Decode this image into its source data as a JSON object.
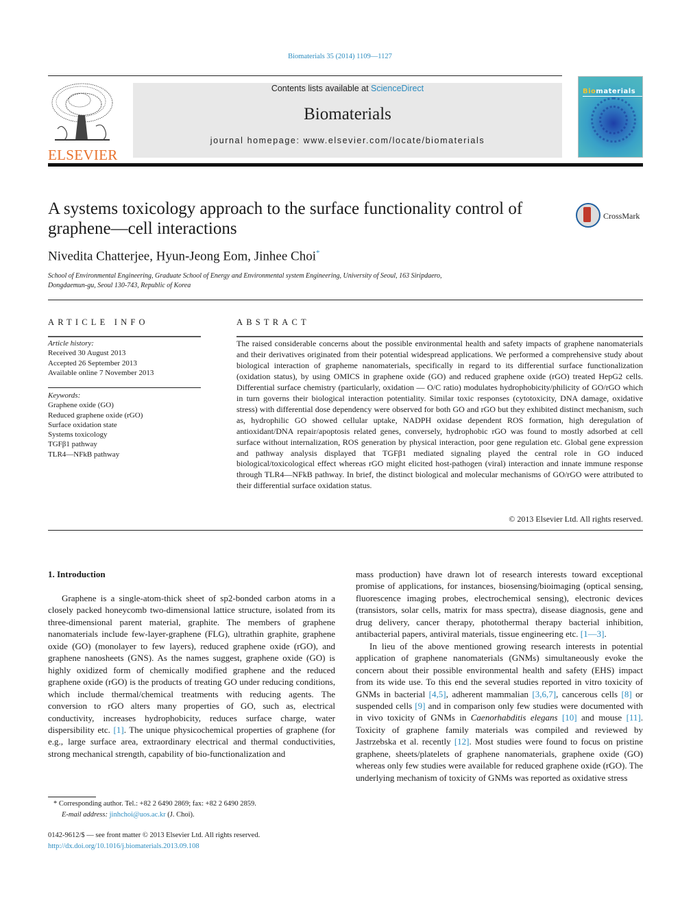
{
  "header": {
    "journal_ref": "Biomaterials 35 (2014) 1109—1127",
    "publisher_logo_text": "ELSEVIER",
    "contents_prefix": "Contents lists available at ",
    "contents_link": "ScienceDirect",
    "journal_name": "Biomaterials",
    "homepage": "journal homepage: www.elsevier.com/locate/biomaterials",
    "cover_title_highlight": "Bio",
    "cover_title_rest": "materials"
  },
  "article": {
    "title": "A systems toxicology approach to the surface functionality control of graphene—cell interactions",
    "crossmark_label": "CrossMark",
    "authors": "Nivedita Chatterjee, Hyun-Jeong Eom, Jinhee Choi",
    "corresponding_mark": "*",
    "affiliation_line1": "School of Environmental Engineering, Graduate School of Energy and Environmental system Engineering, University of Seoul, 163 Siripdaero,",
    "affiliation_line2": "Dongdaemun-gu, Seoul 130-743, Republic of Korea"
  },
  "article_info": {
    "heading": "ARTICLE INFO",
    "history_label": "Article history:",
    "history": [
      "Received 30 August 2013",
      "Accepted 26 September 2013",
      "Available online 7 November 2013"
    ],
    "keywords_label": "Keywords:",
    "keywords": [
      "Graphene oxide (GO)",
      "Reduced graphene oxide (rGO)",
      "Surface oxidation state",
      "Systems toxicology",
      "TGFβ1 pathway",
      "TLR4—NFkB pathway"
    ]
  },
  "abstract": {
    "heading": "ABSTRACT",
    "text": "The raised considerable concerns about the possible environmental health and safety impacts of graphene nanomaterials and their derivatives originated from their potential widespread applications. We performed a comprehensive study about biological interaction of grapheme nanomaterials, specifically in regard to its differential surface functionalization (oxidation status), by using OMICS in graphene oxide (GO) and reduced graphene oxide (rGO) treated HepG2 cells. Differential surface chemistry (particularly, oxidation — O/C ratio) modulates hydrophobicity/philicity of GO/rGO which in turn governs their biological interaction potentiality. Similar toxic responses (cytotoxicity, DNA damage, oxidative stress) with differential dose dependency were observed for both GO and rGO but they exhibited distinct mechanism, such as, hydrophilic GO showed cellular uptake, NADPH oxidase dependent ROS formation, high deregulation of antioxidant/DNA repair/apoptosis related genes, conversely, hydrophobic rGO was found to mostly adsorbed at cell surface without internalization, ROS generation by physical interaction, poor gene regulation etc. Global gene expression and pathway analysis displayed that TGFβ1 mediated signaling played the central role in GO induced biological/toxicological effect whereas rGO might elicited host-pathogen (viral) interaction and innate immune response through TLR4—NFkB pathway. In brief, the distinct biological and molecular mechanisms of GO/rGO were attributed to their differential surface oxidation status.",
    "copyright": "© 2013 Elsevier Ltd. All rights reserved."
  },
  "introduction": {
    "heading": "1.  Introduction",
    "left_p1_a": "Graphene is a single-atom-thick sheet of sp2-bonded carbon atoms in a closely packed honeycomb two-dimensional lattice structure, isolated from its three-dimensional parent material, graphite. The members of graphene nanomaterials include few-layer-graphene (FLG), ultrathin graphite, graphene oxide (GO) (monolayer to few layers), reduced graphene oxide (rGO), and graphene nanosheets (GNS). As the names suggest, graphene oxide (GO) is highly oxidized form of chemically modified graphene and the reduced graphene oxide (rGO) is the products of treating GO under reducing conditions, which include thermal/chemical treatments with reducing agents. The conversion to rGO alters many properties of GO, such as, electrical conductivity, increases hydrophobicity, reduces surface charge, water dispersibility etc. ",
    "ref_1": "[1]",
    "left_p1_b": ". The unique physicochemical properties of graphene (for e.g., large surface area, extraordinary electrical and thermal conductivities, strong mechanical strength, capability of bio-functionalization and",
    "right_p1_a": "mass production) have drawn lot of research interests toward exceptional promise of applications, for instances, biosensing/bioimaging (optical sensing, fluorescence imaging probes, electrochemical sensing), electronic devices (transistors, solar cells, matrix for mass spectra), disease diagnosis, gene and drug delivery, cancer therapy, photothermal therapy bacterial inhibition, antibacterial papers, antiviral materials, tissue engineering etc. ",
    "ref_1_3": "[1—3]",
    "right_p2_a": "In lieu of the above mentioned growing research interests in potential application of graphene nanomaterials (GNMs) simultaneously evoke the concern about their possible environmental health and safety (EHS) impact from its wide use. To this end the several studies reported in vitro toxicity of GNMs in bacterial ",
    "ref_4_5": "[4,5]",
    "right_p2_b": ", adherent mammalian ",
    "ref_3_6_7": "[3,6,7]",
    "right_p2_c": ", cancerous cells ",
    "ref_8": "[8]",
    "right_p2_d": " or suspended cells ",
    "ref_9": "[9]",
    "right_p2_e": " and in comparison only few studies were documented with in vivo toxicity of GNMs in ",
    "species": "Caenorhabditis elegans",
    "ref_10": "[10]",
    "right_p2_f": " and mouse ",
    "ref_11": "[11]",
    "right_p2_g": ". Toxicity of graphene family materials was compiled and reviewed by Jastrzebska et al. recently ",
    "ref_12": "[12]",
    "right_p2_h": ". Most studies were found to focus on pristine graphene, sheets/platelets of graphene nanomaterials, graphene oxide (GO) whereas only few studies were available for reduced graphene oxide (rGO). The underlying mechanism of toxicity of GNMs was reported as oxidative stress"
  },
  "footnotes": {
    "corresponding": "* Corresponding author. Tel.: +82 2 6490 2869; fax: +82 2 6490 2859.",
    "email_label": "E-mail address: ",
    "email": "jinhchoi@uos.ac.kr",
    "email_suffix": " (J. Choi).",
    "issn_line": "0142-9612/$ — see front matter © 2013 Elsevier Ltd. All rights reserved.",
    "doi": "http://dx.doi.org/10.1016/j.biomaterials.2013.09.108"
  }
}
